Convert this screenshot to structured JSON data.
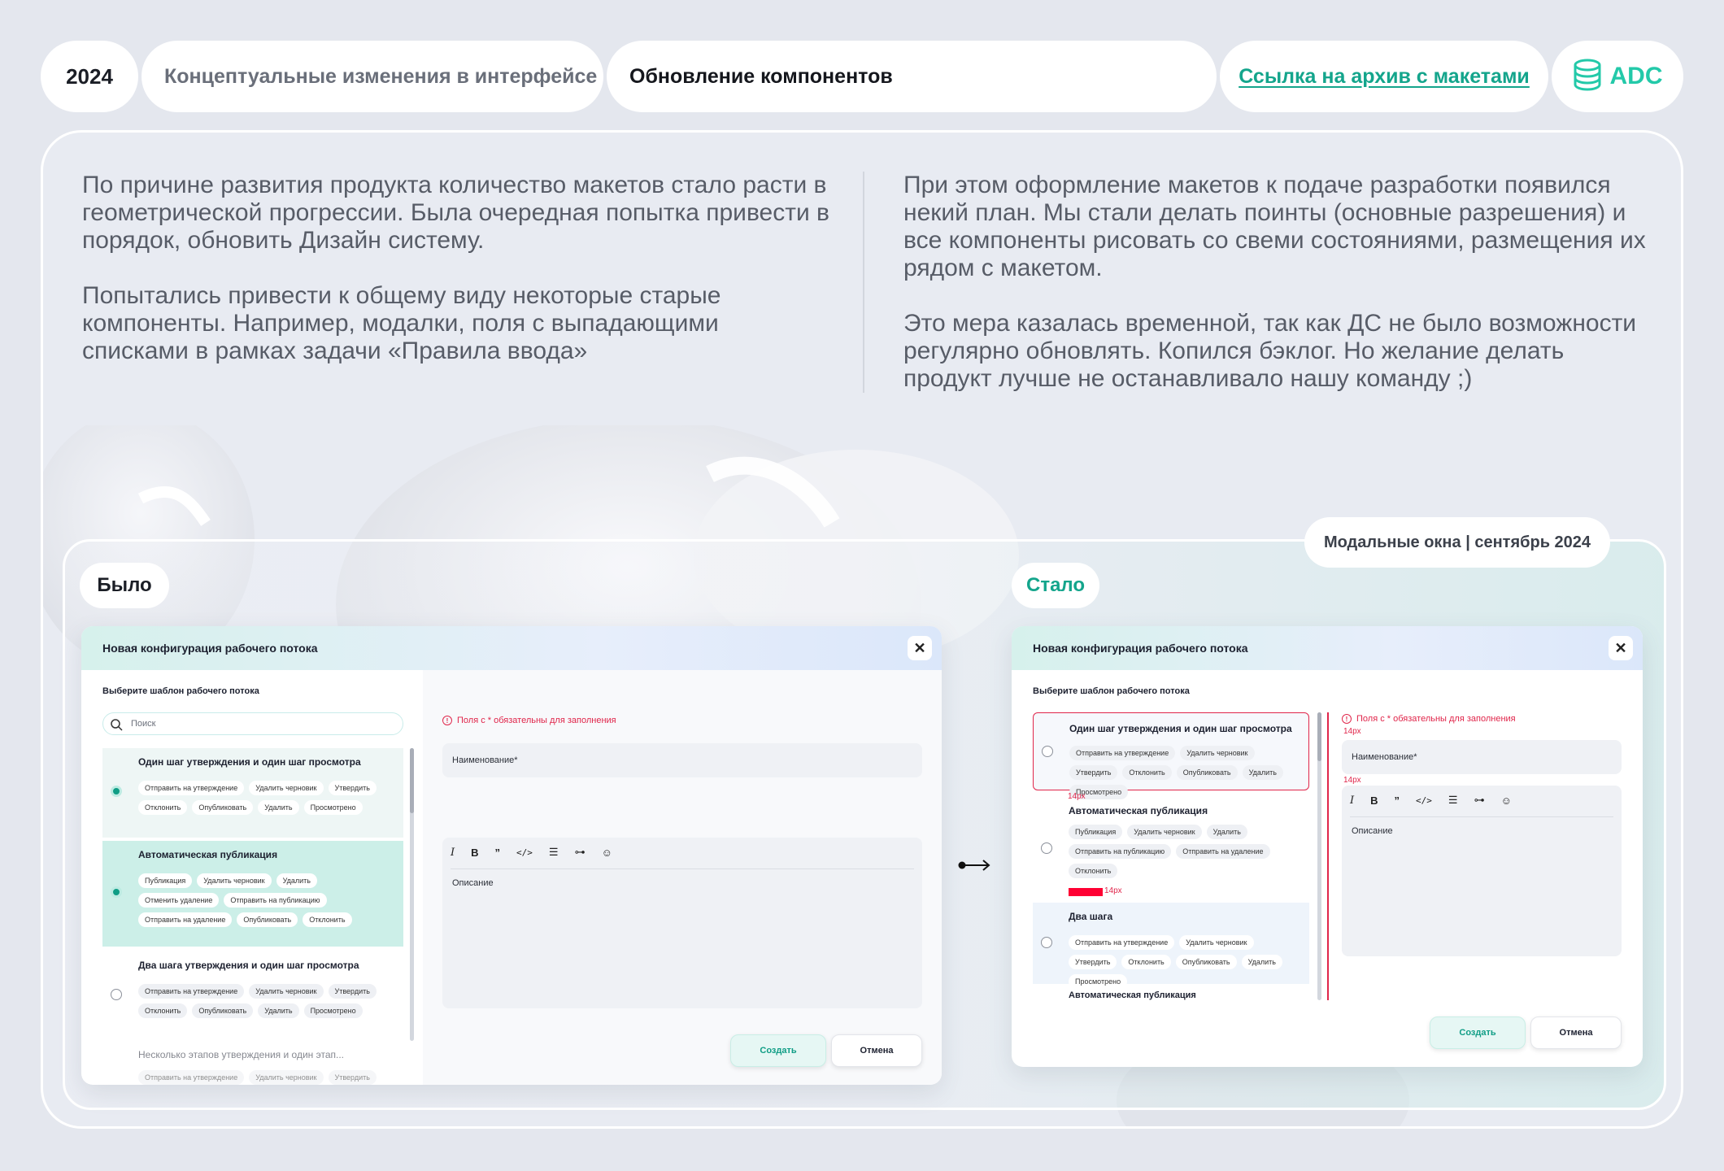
{
  "header": {
    "year": "2024",
    "section": "Концептуальные изменения в интерфейсе",
    "topic": "Обновление компонентов",
    "archive_link": "Ссылка на архив с макетами",
    "logo_text": "ADC"
  },
  "intro": {
    "left_p1": "По причине развития продукта количество макетов стало расти в геометрической прогрессии. Была очередная попытка привести в порядок, обновить Дизайн систему.",
    "left_p2": "Попытались привести к общему виду некоторые старые компоненты. Например, модалки, поля с выпадающими списками в рамках задачи «Правила ввода»",
    "right_p1": "При этом оформление макетов к подаче разработки появился некий план. Мы стали делать поинты (основные разрешения) и все компоненты рисовать со свеми состояниями, размещения их рядом с макетом.",
    "right_p2": "Это мера казалась временной, так как ДС не было возможности регулярно обновлять. Копился бэклог. Но желание делать продукт лучше не останавливало нашу команду ;)"
  },
  "compare": {
    "caption": "Модальные окна | сентябрь 2024",
    "before_label": "Было",
    "after_label": "Стало"
  },
  "modal_old": {
    "title": "Новая конфигурация рабочего потока",
    "template_label": "Выберите шаблон рабочего потока",
    "search_placeholder": "Поиск",
    "items": [
      {
        "title": "Один шаг утверждения и один шаг просмотра",
        "chips": [
          "Отправить на утверждение",
          "Удалить черновик",
          "Утвердить",
          "Отклонить",
          "Опубликовать",
          "Удалить",
          "Просмотрено"
        ]
      },
      {
        "title": "Автоматическая публикация",
        "chips": [
          "Публикация",
          "Удалить черновик",
          "Удалить",
          "Отменить удаление",
          "Отправить на публикацию",
          "Отправить на удаление",
          "Опубликовать",
          "Отклонить"
        ]
      },
      {
        "title": "Два шага утверждения и один шаг просмотра",
        "chips": [
          "Отправить на утверждение",
          "Удалить черновик",
          "Утвердить",
          "Отклонить",
          "Опубликовать",
          "Удалить",
          "Просмотрено"
        ]
      },
      {
        "title": "Несколько этапов утверждения и один этап...",
        "chips": [
          "Отправить на утверждение",
          "Удалить черновик",
          "Утвердить"
        ]
      }
    ],
    "required_note": "Поля с * обязательны для заполнения",
    "name_field": "Наименование*",
    "description": "Описание",
    "create_button": "Создать",
    "cancel_button": "Отмена"
  },
  "modal_new": {
    "title": "Новая конфигурация рабочего потока",
    "template_label": "Выберите шаблон рабочего потока",
    "items": [
      {
        "title": "Один шаг утверждения и один шаг просмотра",
        "chips": [
          "Отправить на утверждение",
          "Удалить черновик",
          "Утвердить",
          "Отклонить",
          "Опубликовать",
          "Удалить",
          "Просмотрено"
        ]
      },
      {
        "title": "Автоматическая публикация",
        "chips": [
          "Публикация",
          "Удалить черновик",
          "Удалить",
          "Отправить на публикацию",
          "Отправить на удаление",
          "Отклонить"
        ]
      },
      {
        "title": "Два шага",
        "chips": [
          "Отправить на утверждение",
          "Удалить черновик",
          "Утвердить",
          "Отклонить",
          "Опубликовать",
          "Удалить",
          "Просмотрено"
        ]
      },
      {
        "title": "Автоматическая публикация",
        "chips": []
      }
    ],
    "spacing_note": "14px",
    "required_note": "Поля с * обязательны для заполнения",
    "name_field": "Наименование*",
    "description": "Описание",
    "create_button": "Создать",
    "cancel_button": "Отмена"
  },
  "colors": {
    "accent": "#14a58c",
    "error": "#e0254a",
    "background": "#e4e7ee"
  }
}
